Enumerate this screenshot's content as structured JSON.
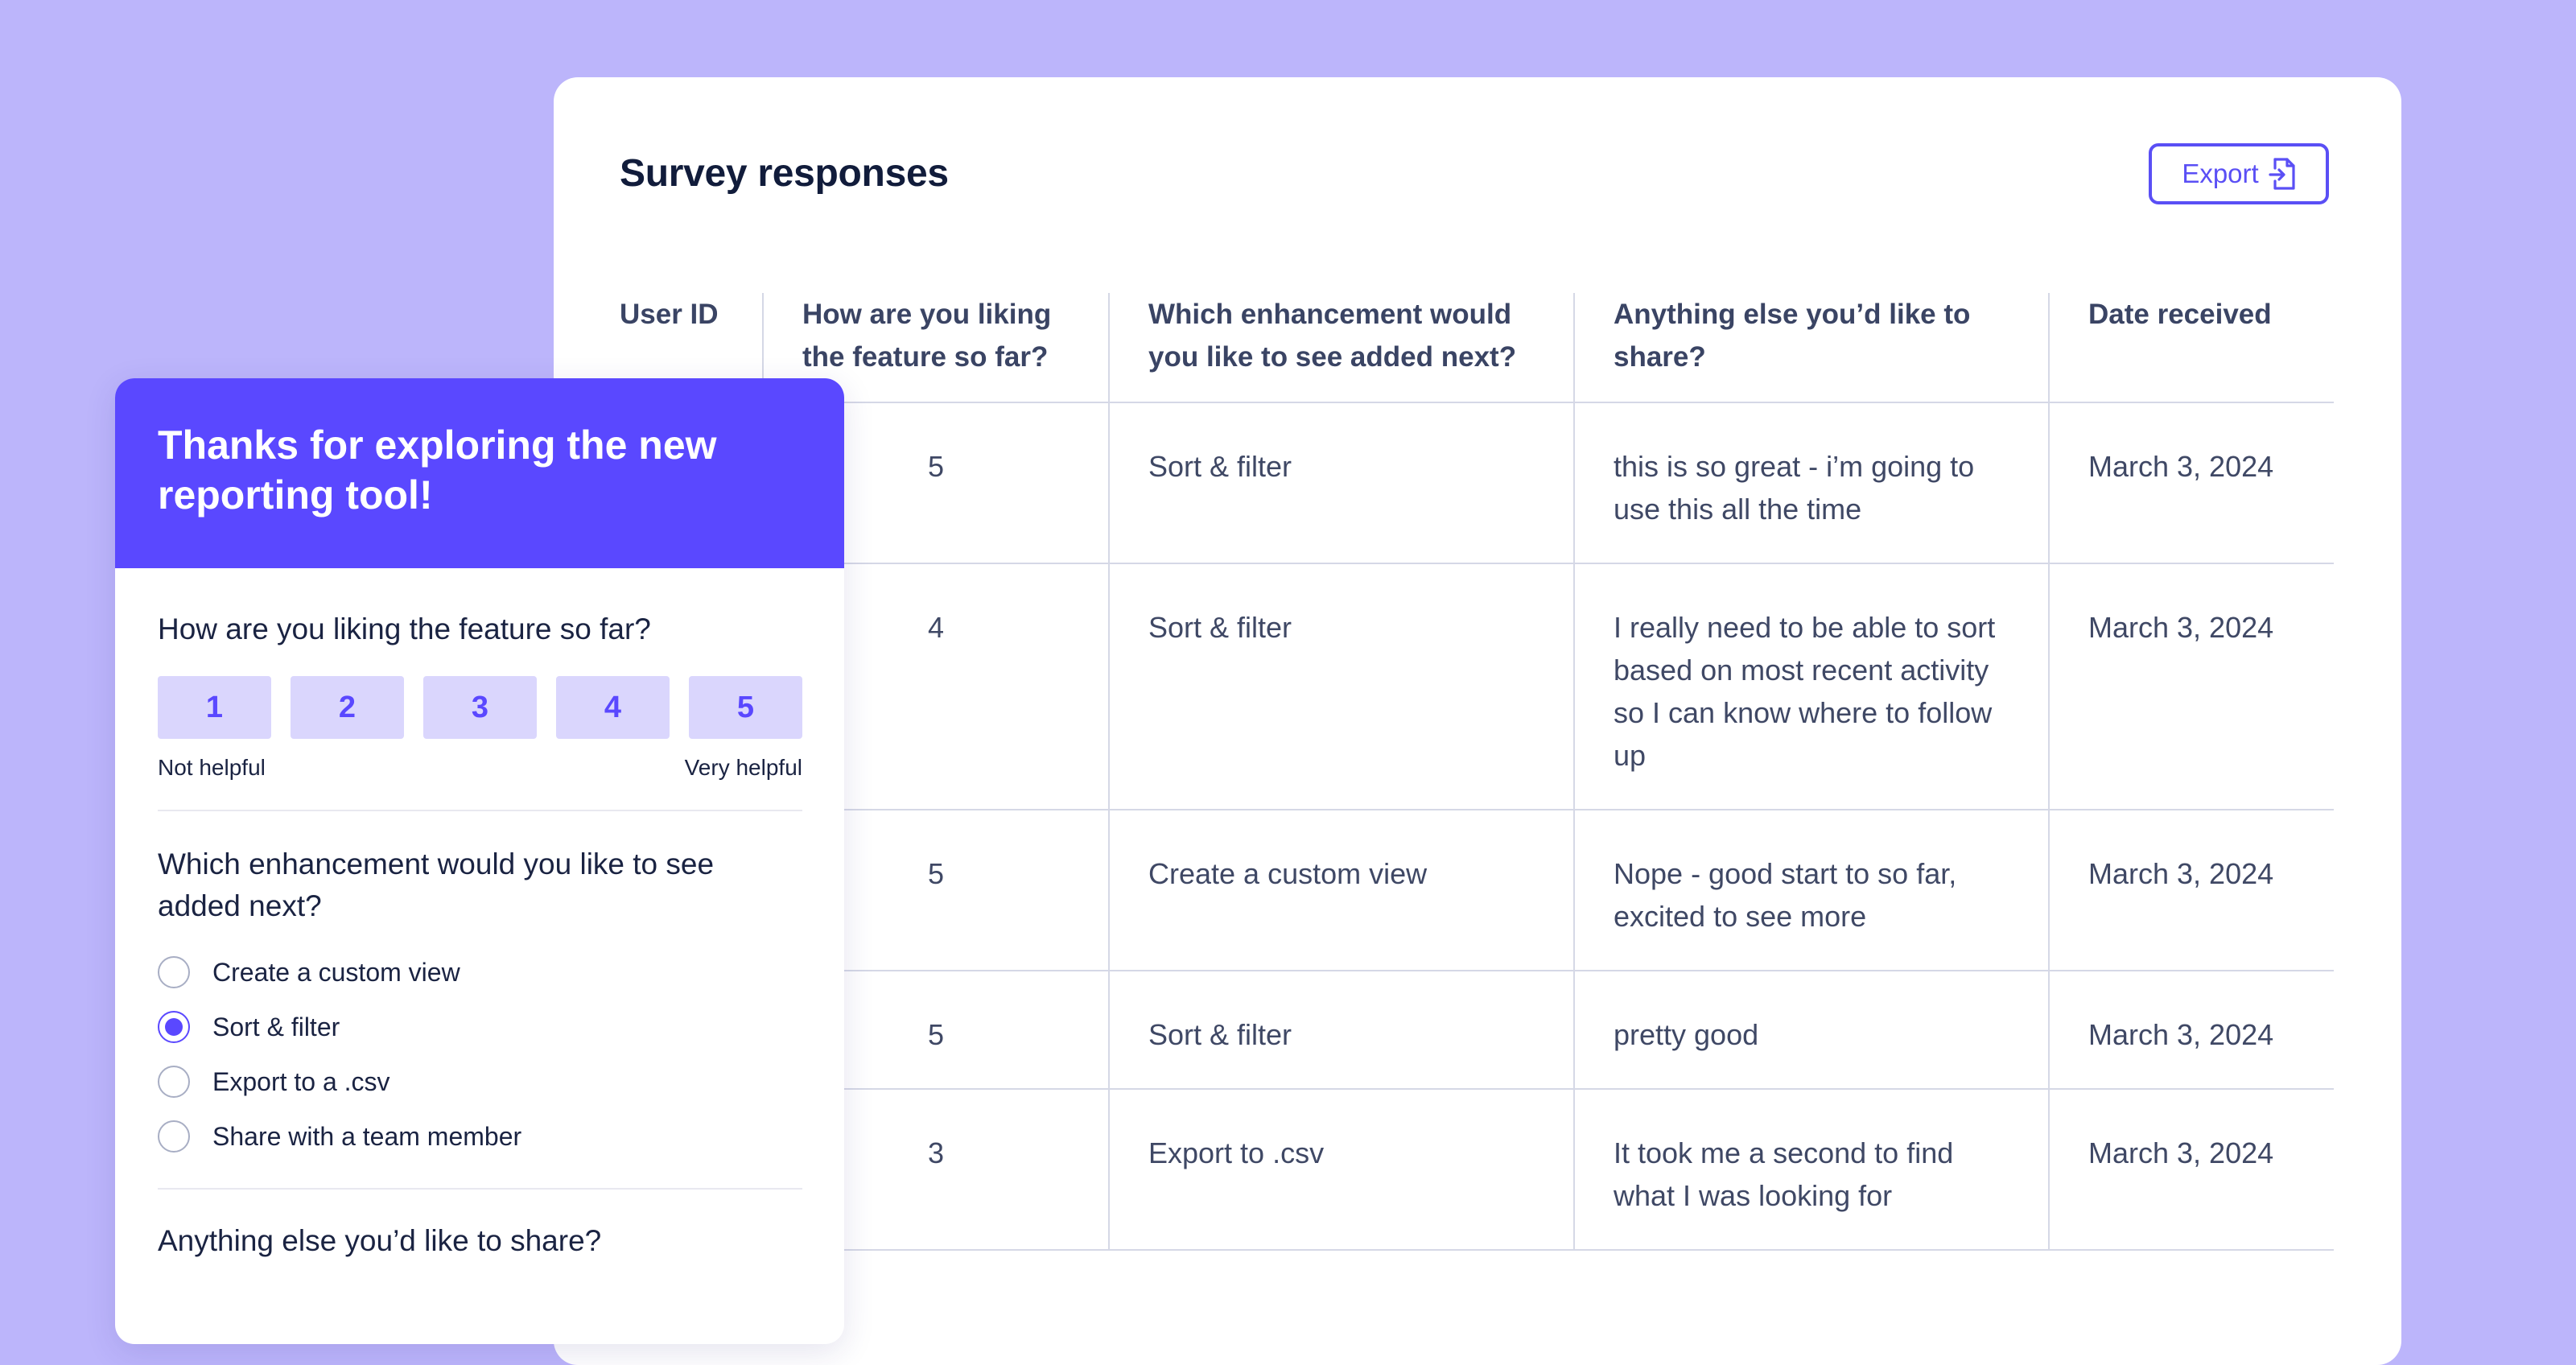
{
  "colors": {
    "background": "#bcb5fb",
    "accent": "#5a48ff",
    "card": "#ffffff"
  },
  "table_card": {
    "title": "Survey responses",
    "export_label": "Export",
    "export_icon": "file-export-icon",
    "columns": [
      "User ID",
      "How are you liking the feature so far?",
      "Which enhancement would you like to see added next?",
      "Anything else you’d like to share?",
      "Date received"
    ],
    "rows": [
      {
        "score": "5",
        "enhancement": "Sort & filter",
        "comment": "this is so great - i’m going to use this all the time",
        "date": "March 3, 2024"
      },
      {
        "score": "4",
        "enhancement": "Sort & filter",
        "comment": "I really need to be able to sort based on most recent activity so I can know where to follow up",
        "date": "March 3, 2024"
      },
      {
        "score": "5",
        "enhancement": "Create a custom view",
        "comment": "Nope - good start to so far, excited to see more",
        "date": "March 3, 2024"
      },
      {
        "score": "5",
        "enhancement": "Sort & filter",
        "comment": "pretty good",
        "date": "March 3, 2024"
      },
      {
        "score": "3",
        "enhancement": "Export to .csv",
        "comment": "It took me a second to find what I was looking for",
        "date": "March 3, 2024"
      }
    ]
  },
  "survey": {
    "heading": "Thanks for exploring the new reporting tool!",
    "q1": "How are you liking the feature so far?",
    "scale": [
      "1",
      "2",
      "3",
      "4",
      "5"
    ],
    "scale_low": "Not helpful",
    "scale_high": "Very helpful",
    "q2": "Which enhancement would you like to see added next?",
    "options": [
      {
        "label": "Create a custom view",
        "selected": false
      },
      {
        "label": "Sort & filter",
        "selected": true
      },
      {
        "label": "Export to a .csv",
        "selected": false
      },
      {
        "label": "Share with a team member",
        "selected": false
      }
    ],
    "q3": "Anything else you’d like to share?"
  }
}
